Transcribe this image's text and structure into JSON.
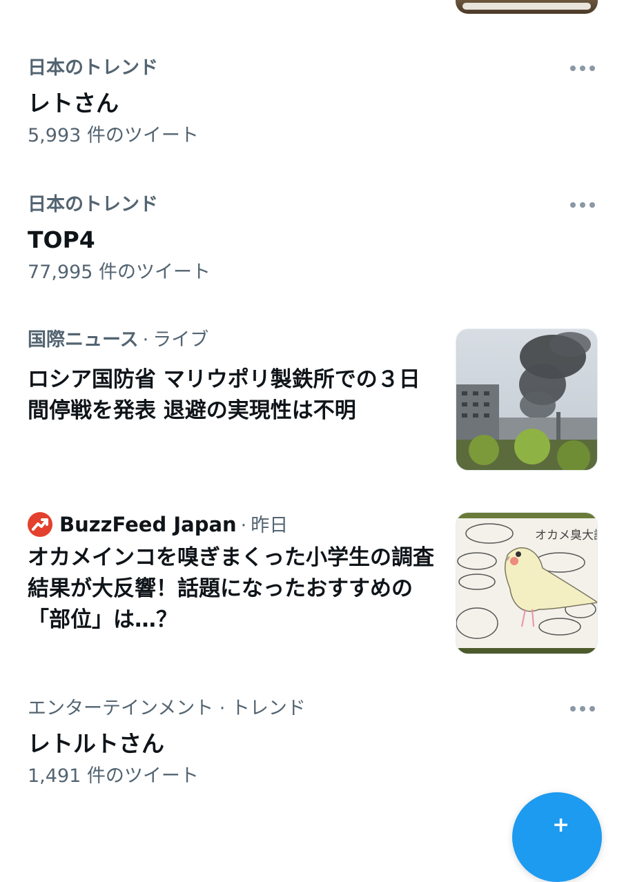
{
  "trends": [
    {
      "meta": "日本のトレンド",
      "title": "レトさん",
      "count": "5,993 件のツイート"
    },
    {
      "meta": "日本のトレンド",
      "title": "TOP4",
      "count": "77,995 件のツイート"
    }
  ],
  "news": [
    {
      "category": "国際ニュース",
      "separator": "·",
      "status": "ライブ",
      "headline": "ロシア国防省 マリウポリ製鉄所での３日間停戦を発表 退避の実現性は不明",
      "image_icon": "smoke-factory-photo"
    },
    {
      "source": "BuzzFeed Japan",
      "separator": "·",
      "time": "昨日",
      "source_icon": "buzzfeed-trending-arrow-icon",
      "source_color": "#e3402d",
      "headline": "オカメインコを嗅ぎまくった小学生の調査結果が大反響！話題になったおすすめの「部位」は…？",
      "image_icon": "cockatiel-drawing-photo",
      "image_text": "オカメ臭大調査"
    }
  ],
  "trend_last": {
    "meta": "エンターテインメント · トレンド",
    "title": "レトルトさん",
    "count": "1,491 件のツイート"
  },
  "colors": {
    "accent": "#1d9bf0",
    "secondary_text": "#536471",
    "primary_text": "#0f1419"
  },
  "fab": {
    "icon": "compose-plus-icon",
    "label": "+"
  }
}
